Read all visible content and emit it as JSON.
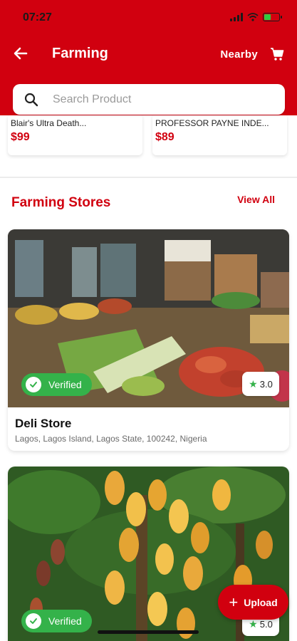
{
  "status_bar": {
    "time": "07:27"
  },
  "navbar": {
    "title": "Farming",
    "nearby_label": "Nearby"
  },
  "search": {
    "placeholder": "Search Product",
    "value": ""
  },
  "products": [
    {
      "name": "Blair's Ultra Death...",
      "price": "$99"
    },
    {
      "name": "PROFESSOR PAYNE INDE...",
      "price": "$89"
    }
  ],
  "section": {
    "title": "Farming Stores",
    "view_all": "View All"
  },
  "stores": [
    {
      "name": "Deli Store",
      "address": "Lagos, Lagos Island, Lagos State, 100242, Nigeria",
      "verified_label": "Verified",
      "rating": "3.0"
    },
    {
      "verified_label": "Verified",
      "rating": "5.0"
    }
  ],
  "fab": {
    "label": "Upload"
  },
  "colors": {
    "brand": "#d1000f",
    "verified": "#34b24a"
  }
}
